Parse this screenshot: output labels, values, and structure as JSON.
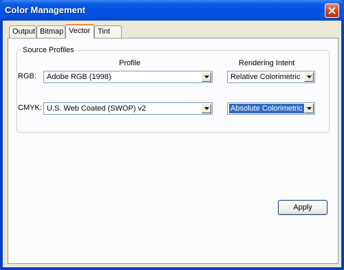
{
  "window": {
    "title": "Color Management"
  },
  "tabs": [
    {
      "label": "Output",
      "active": false
    },
    {
      "label": "Bitmap",
      "active": false
    },
    {
      "label": "Vector",
      "active": true
    },
    {
      "label": "Tint",
      "active": false
    }
  ],
  "source_profiles": {
    "group_label": "Source Profiles",
    "profile_header": "Profile",
    "intent_header": "Rendering Intent",
    "rows": [
      {
        "label": "RGB:",
        "profile": "Adobe RGB (1998)",
        "intent": "Relative Colorimetric"
      },
      {
        "label": "CMYK:",
        "profile": "U.S. Web Coated (SWOP) v2",
        "intent": "Absolute Colorimetric"
      }
    ]
  },
  "buttons": {
    "apply": "Apply"
  },
  "icons": {
    "close": "close-icon",
    "dropdown": "chevron-down-icon"
  },
  "colors": {
    "titlebar": "#0353de",
    "tab_highlight": "#e68b2c",
    "selection": "#316ac5",
    "close_button": "#c4411e"
  }
}
